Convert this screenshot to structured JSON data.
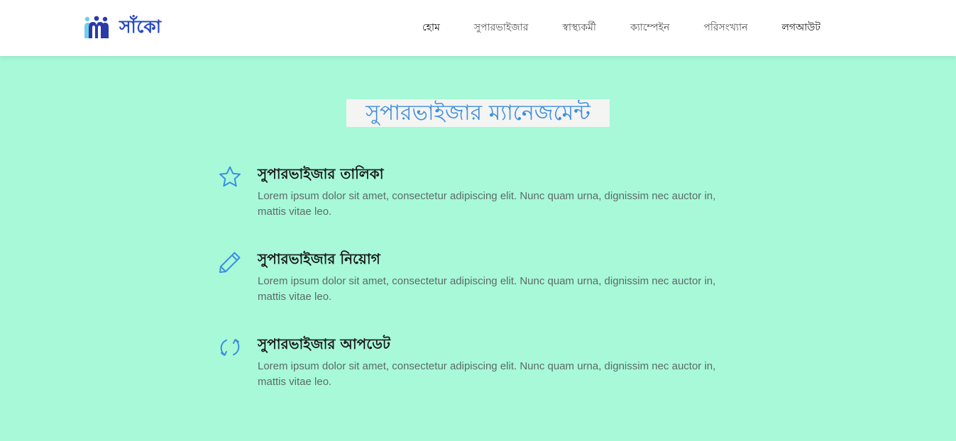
{
  "brand": {
    "name": "সাঁকো",
    "logo_icon": "people-group-icon",
    "colors": {
      "text": "#2549c4",
      "person_light": "#6fd0e4",
      "person_dark": "#2a3aa8"
    }
  },
  "nav": {
    "items": [
      {
        "label": "হোম",
        "style": "dark"
      },
      {
        "label": "সুপারভাইজার",
        "style": "muted"
      },
      {
        "label": "স্বাস্থ্যকর্মী",
        "style": "muted"
      },
      {
        "label": "ক্যাম্পেইন",
        "style": "muted"
      },
      {
        "label": "পরিসংখ্যান",
        "style": "muted"
      },
      {
        "label": "লগআউট",
        "style": "dark"
      }
    ]
  },
  "main": {
    "title": "সুপারভাইজার ম্যানেজমেন্ট",
    "features": [
      {
        "icon": "star-icon",
        "title": "সুপারভাইজার তালিকা",
        "description": "Lorem ipsum dolor sit amet, consectetur adipiscing elit. Nunc quam urna, dignissim nec auctor in, mattis vitae leo."
      },
      {
        "icon": "pencil-icon",
        "title": "সুপারভাইজার নিয়োগ",
        "description": "Lorem ipsum dolor sit amet, consectetur adipiscing elit. Nunc quam urna, dignissim nec auctor in, mattis vitae leo."
      },
      {
        "icon": "refresh-icon",
        "title": "সুপারভাইজার আপডেট",
        "description": "Lorem ipsum dolor sit amet, consectetur adipiscing elit. Nunc quam urna, dignissim nec auctor in, mattis vitae leo."
      }
    ]
  },
  "colors": {
    "page_background": "#a7f9d8",
    "navbar_background": "#ffffff",
    "title_color": "#3c8ee0",
    "title_background": "#f4f4f2",
    "icon_color": "#3c8ee0"
  }
}
